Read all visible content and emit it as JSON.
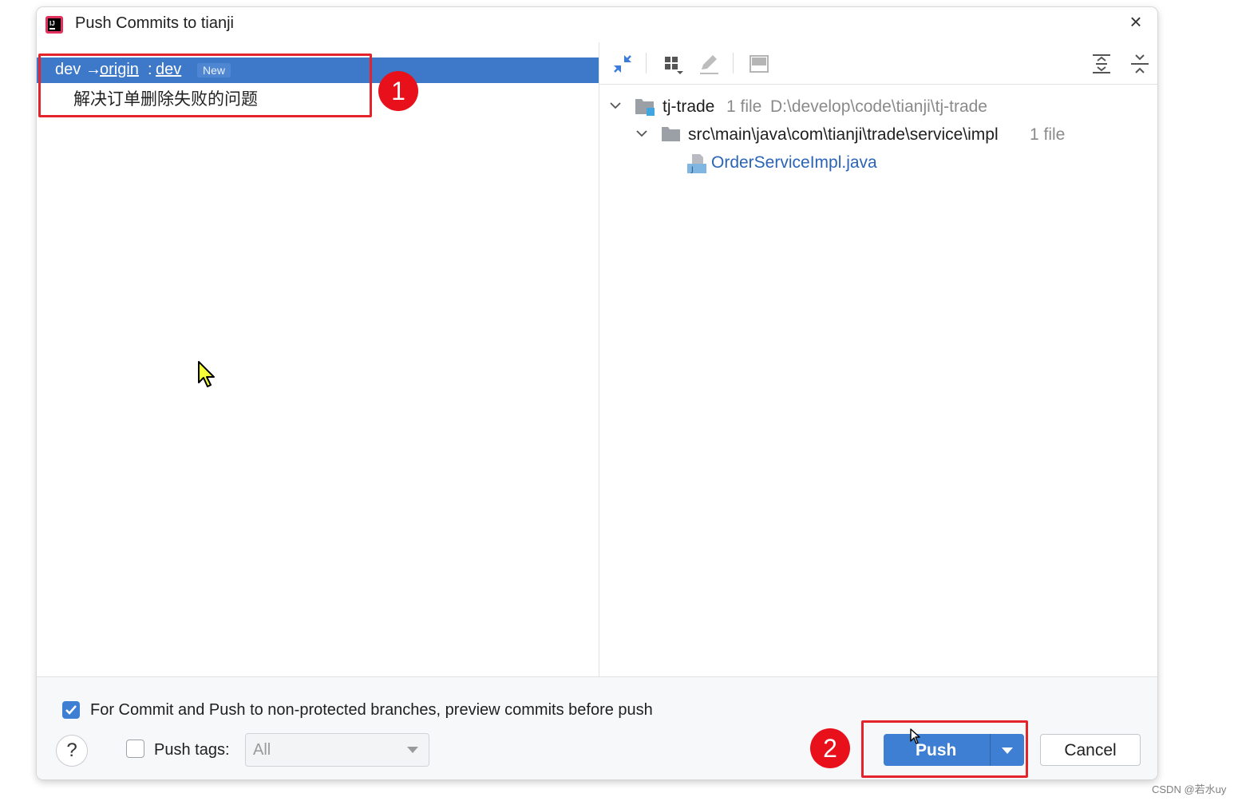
{
  "dialog": {
    "title": "Push Commits to tianji",
    "close_glyph": "×"
  },
  "left": {
    "repo_row": {
      "local_branch": "dev",
      "arrow": "→",
      "remote": "origin",
      "separator": ":",
      "remote_branch": "dev",
      "badge": "New"
    },
    "commits": [
      {
        "message": "解决订单删除失败的问题"
      }
    ]
  },
  "annotations": {
    "badge1": "1",
    "badge2": "2",
    "color": "#e4242d"
  },
  "toolbar": {
    "icons": [
      "collapse-diff-icon",
      "group-by-icon",
      "edit-source-icon",
      "preview-diff-icon",
      "expand-all-icon",
      "collapse-all-icon"
    ]
  },
  "tree": {
    "root": {
      "name": "tj-trade",
      "count": "1 file",
      "path": "D:\\develop\\code\\tianji\\tj-trade"
    },
    "folder": {
      "name": "src\\main\\java\\com\\tianji\\trade\\service\\impl",
      "count": "1 file"
    },
    "file": {
      "name": "OrderServiceImpl.java"
    }
  },
  "bottom": {
    "preview_checkbox_checked": true,
    "preview_label": "For Commit and Push to non-protected branches, preview commits before push",
    "help_glyph": "?",
    "push_tags_checked": false,
    "push_tags_label": "Push tags:",
    "push_tags_value": "All",
    "push_label": "Push",
    "cancel_label": "Cancel"
  },
  "watermark": "CSDN @若水uy",
  "colors": {
    "accent": "#3e7fd3",
    "selection": "#3e79c9",
    "link": "#2b64b7"
  }
}
